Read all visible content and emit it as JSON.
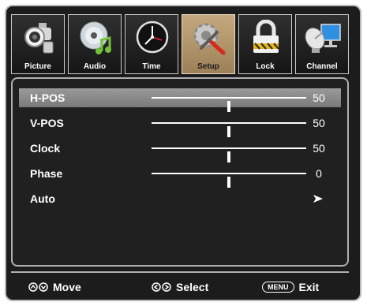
{
  "tabs": [
    {
      "label": "Picture",
      "icon": "camcorder-icon",
      "active": false
    },
    {
      "label": "Audio",
      "icon": "music-cd-icon",
      "active": false
    },
    {
      "label": "Time",
      "icon": "clock-icon",
      "active": false
    },
    {
      "label": "Setup",
      "icon": "setup-tools-icon",
      "active": true
    },
    {
      "label": "Lock",
      "icon": "padlock-icon",
      "active": false
    },
    {
      "label": "Channel",
      "icon": "satellite-dish-icon",
      "active": false
    }
  ],
  "settings": [
    {
      "name": "H-POS",
      "value": "50",
      "level": 0.5,
      "selected": true
    },
    {
      "name": "V-POS",
      "value": "50",
      "level": 0.5,
      "selected": false
    },
    {
      "name": "Clock",
      "value": "50",
      "level": 0.5,
      "selected": false
    },
    {
      "name": "Phase",
      "value": "0",
      "level": 0.5,
      "selected": false
    },
    {
      "name": "Auto",
      "value": "",
      "selected": false,
      "has_arrow": true
    }
  ],
  "help": {
    "move_label": "Move",
    "select_label": "Select",
    "menu_key": "MENU",
    "exit_label": "Exit"
  },
  "colors": {
    "active_tab": "#b8996d",
    "background": "#1c1c1c",
    "highlight": "#8a8a8a"
  }
}
